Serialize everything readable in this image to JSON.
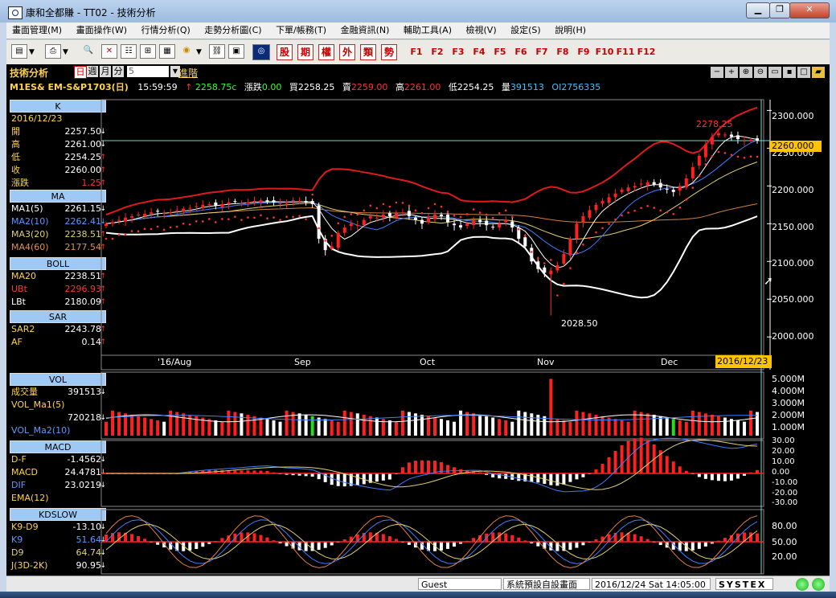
{
  "window": {
    "title": "康和全都賺 - TT02 - 技術分析",
    "minimize": "▁",
    "restore": "❐",
    "close": "✕"
  },
  "menu": [
    "畫面管理(M)",
    "畫面操作(W)",
    "行情分析(Q)",
    "走勢分析圖(C)",
    "下單/帳務(T)",
    "金融資訊(N)",
    "輔助工具(A)",
    "檢視(V)",
    "設定(S)",
    "說明(H)"
  ],
  "toolbar": {
    "order_buttons": [
      "股",
      "期",
      "權",
      "外",
      "類",
      "勢"
    ],
    "fkeys": [
      "F1",
      "F2",
      "F3",
      "F4",
      "F5",
      "F6",
      "F7",
      "F8",
      "F9",
      "F10",
      "F11",
      "F12"
    ]
  },
  "info": {
    "panel_title": "技術分析",
    "periods": [
      "日",
      "週",
      "月",
      "分"
    ],
    "period_value": "5",
    "advanced": "進階",
    "symbol": "M1ES& EM-S&P1703(日)",
    "time": "15:59:59",
    "arrow": "↑",
    "last_price": "2258.75c",
    "change_label": "漲跌",
    "change_value": "0.00",
    "bid_label": "買",
    "bid_value": "2258.25",
    "ask_label": "賣",
    "ask_value": "2259.00",
    "high_label": "高",
    "high_value": "2261.00",
    "low_label": "低",
    "low_value": "2254.25",
    "vol_label": "量",
    "vol_value": "391513",
    "oi_label": "OI",
    "oi_value": "2756335"
  },
  "left_panel": {
    "k": {
      "header": "K",
      "date": "2016/12/23",
      "rows": [
        {
          "k": "開",
          "v": "2257.50",
          "a": "↓"
        },
        {
          "k": "高",
          "v": "2261.00",
          "a": "↓"
        },
        {
          "k": "低",
          "v": "2254.25",
          "a": "↑"
        },
        {
          "k": "收",
          "v": "2260.00",
          "a": "↑"
        },
        {
          "k": "漲跌",
          "v": "1.25",
          "a": "↑"
        }
      ]
    },
    "ma": {
      "header": "MA",
      "rows": [
        {
          "k": "MA1(5)",
          "v": "2261.15",
          "a": "↓"
        },
        {
          "k": "MA2(10)",
          "v": "2262.41",
          "a": "↓"
        },
        {
          "k": "MA3(20)",
          "v": "2238.51",
          "a": "↑"
        },
        {
          "k": "MA4(60)",
          "v": "2177.54",
          "a": "↑"
        }
      ]
    },
    "boll": {
      "header": "BOLL",
      "rows": [
        {
          "k": "MA20",
          "v": "2238.51",
          "a": "↑"
        },
        {
          "k": "UBt",
          "v": "2296.93",
          "a": "↑"
        },
        {
          "k": "LBt",
          "v": "2180.09",
          "a": "↑"
        }
      ]
    },
    "sar": {
      "header": "SAR",
      "rows": [
        {
          "k": "SAR2",
          "v": "2243.78",
          "a": "↑"
        },
        {
          "k": "AF",
          "v": "0.14",
          "a": "↑"
        }
      ]
    },
    "vol": {
      "header": "VOL",
      "rows": [
        {
          "k": "成交量",
          "v": "391513",
          "a": "↓"
        },
        {
          "k": "VOL_Ma1(5)",
          "v": "",
          "a": ""
        },
        {
          "k": "",
          "v": "720218",
          "a": "↓"
        },
        {
          "k": "VOL_Ma2(10)",
          "v": "",
          "a": ""
        }
      ]
    },
    "macd": {
      "header": "MACD",
      "rows": [
        {
          "k": "D-F",
          "v": "-1.4562",
          "a": "↓"
        },
        {
          "k": "MACD",
          "v": "24.4781",
          "a": "↓"
        },
        {
          "k": "DIF",
          "v": "23.0219",
          "a": "↓"
        },
        {
          "k": "EMA(12)",
          "v": "",
          "a": ""
        }
      ]
    },
    "kd": {
      "header": "KDSLOW",
      "rows": [
        {
          "k": "K9-D9",
          "v": "-13.10",
          "a": "↓"
        },
        {
          "k": "K9",
          "v": "51.64",
          "a": "↓"
        },
        {
          "k": "D9",
          "v": "64.74",
          "a": "↓"
        },
        {
          "k": "J(3D-2K)",
          "v": "90.95",
          "a": "↓"
        }
      ]
    }
  },
  "chart_data": [
    {
      "type": "candlestick",
      "ylim": [
        1980,
        2310
      ],
      "y_ticks": [
        2300,
        2250,
        2200,
        2150,
        2100,
        2050,
        2000
      ],
      "y_tick_labels": [
        "2300.000",
        "2250.000",
        "2200.000",
        "2150.000",
        "2100.000",
        "2050.000",
        "2000.000"
      ],
      "x_labels": [
        "'16/Aug",
        "Sep",
        "Oct",
        "Nov",
        "Dec"
      ],
      "current_price_label": "2260.000",
      "current_price": 2260,
      "cursor_date": "2016/12/23",
      "annotations": [
        {
          "text": "2278.25",
          "value": 2278.25
        },
        {
          "text": "2028.50",
          "value": 2028.5
        }
      ],
      "close_series": [
        2150,
        2152,
        2155,
        2158,
        2160,
        2162,
        2163,
        2165,
        2166,
        2164,
        2165,
        2168,
        2170,
        2171,
        2173,
        2175,
        2176,
        2174,
        2176,
        2178,
        2179,
        2177,
        2178,
        2180,
        2181,
        2179,
        2178,
        2177,
        2179,
        2181,
        2180,
        2178,
        2176,
        2130,
        2115,
        2120,
        2138,
        2145,
        2150,
        2148,
        2155,
        2160,
        2158,
        2162,
        2160,
        2164,
        2165,
        2160,
        2155,
        2150,
        2158,
        2162,
        2160,
        2152,
        2148,
        2145,
        2150,
        2155,
        2152,
        2148,
        2145,
        2150,
        2155,
        2145,
        2130,
        2120,
        2100,
        2090,
        2085,
        2088,
        2095,
        2110,
        2130,
        2150,
        2160,
        2168,
        2175,
        2180,
        2185,
        2190,
        2195,
        2198,
        2200,
        2203,
        2205,
        2202,
        2198,
        2195,
        2192,
        2200,
        2210,
        2225,
        2240,
        2255,
        2265,
        2270,
        2268,
        2265,
        2262,
        2260,
        2261,
        2260
      ]
    },
    {
      "type": "bar",
      "name": "VOL",
      "ylim": [
        0,
        5200000
      ],
      "y_ticks": [
        5000000,
        4000000,
        3000000,
        2000000,
        1000000
      ],
      "y_tick_labels": [
        "5.000M",
        "4.000M",
        "3.000M",
        "2.000M",
        "1.000M"
      ]
    },
    {
      "type": "bar",
      "name": "MACD",
      "ylim": [
        -32,
        32
      ],
      "y_ticks": [
        30,
        20,
        10,
        0,
        -10,
        -20,
        -30
      ],
      "y_tick_labels": [
        "30.00",
        "20.00",
        "10.00",
        "0.00",
        "-10.00",
        "-20.00",
        "-30.00"
      ]
    },
    {
      "type": "line",
      "name": "KDSLOW",
      "ylim": [
        0,
        100
      ],
      "y_ticks": [
        80,
        50,
        20
      ],
      "y_tick_labels": [
        "80.00",
        "50.00",
        "20.00"
      ]
    }
  ],
  "status": {
    "user": "Guest",
    "screen": "系統預設自設畫面",
    "datetime": "2016/12/24 Sat 14:05:00",
    "brand": "SYSTEX"
  },
  "colors": {
    "up": "#ff2020",
    "down": "#ffffff",
    "bb_upper": "#e01a1a",
    "bb_lower": "#ffffff",
    "ma5": "#ffffff",
    "ma10": "#3d7fff",
    "ma20": "#e0d070",
    "ma60": "#d08040",
    "panel_header": "#9ec9f5"
  }
}
